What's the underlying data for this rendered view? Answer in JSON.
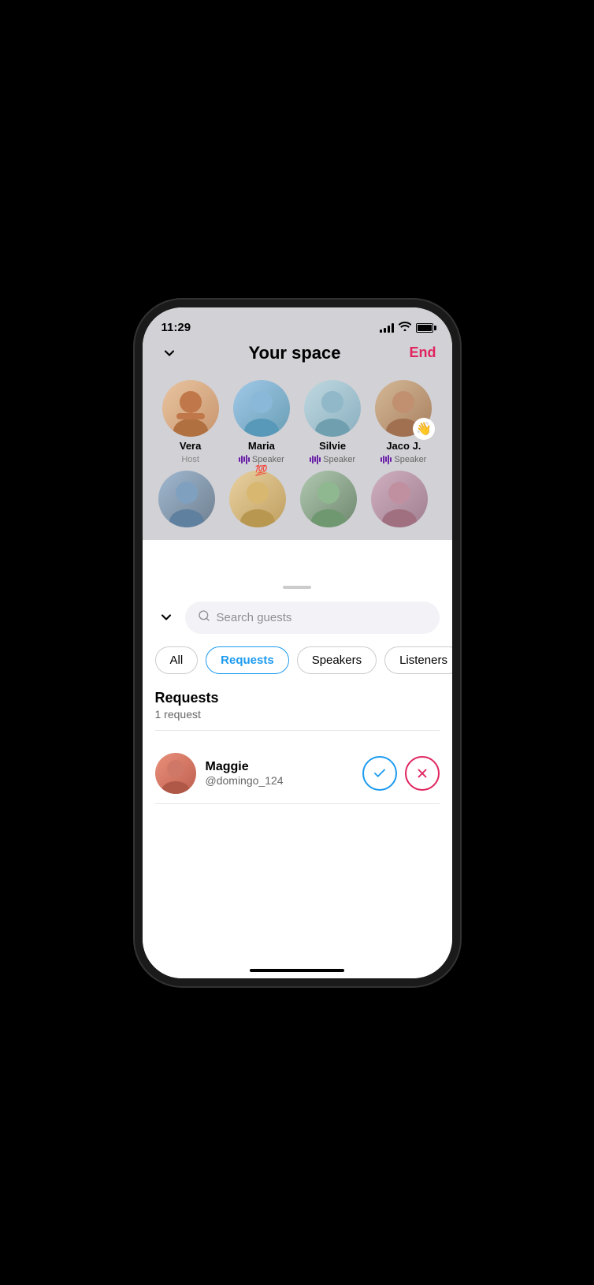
{
  "status_bar": {
    "time": "11:29",
    "signal": "4 bars",
    "wifi": true,
    "battery": "full"
  },
  "header": {
    "title": "Your space",
    "end_label": "End",
    "collapse_icon": "chevron-down"
  },
  "speakers": [
    {
      "name": "Vera",
      "role": "Host",
      "avatar_class": "avatar-vera",
      "has_audio": false,
      "has_wave": false
    },
    {
      "name": "Maria",
      "role": "Speaker",
      "avatar_class": "avatar-maria",
      "has_audio": true,
      "has_wave": false
    },
    {
      "name": "Silvie",
      "role": "Speaker",
      "avatar_class": "avatar-silvie",
      "has_audio": true,
      "has_wave": false
    },
    {
      "name": "Jaco J.",
      "role": "Speaker",
      "avatar_class": "avatar-jaco",
      "has_audio": true,
      "has_wave": true
    }
  ],
  "listeners_partial": [
    {
      "avatar_class": "avatar-listener1"
    },
    {
      "avatar_class": "avatar-listener2"
    },
    {
      "avatar_class": "avatar-listener3"
    },
    {
      "avatar_class": "avatar-listener4"
    }
  ],
  "bottom_sheet": {
    "search_placeholder": "Search guests",
    "filter_tabs": [
      {
        "label": "All",
        "active": false
      },
      {
        "label": "Requests",
        "active": true
      },
      {
        "label": "Speakers",
        "active": false
      },
      {
        "label": "Listeners",
        "active": false
      }
    ],
    "requests_section": {
      "title": "Requests",
      "count_text": "1 request",
      "items": [
        {
          "name": "Maggie",
          "handle": "@domingo_124",
          "avatar_class": "avatar-maggie"
        }
      ]
    }
  }
}
